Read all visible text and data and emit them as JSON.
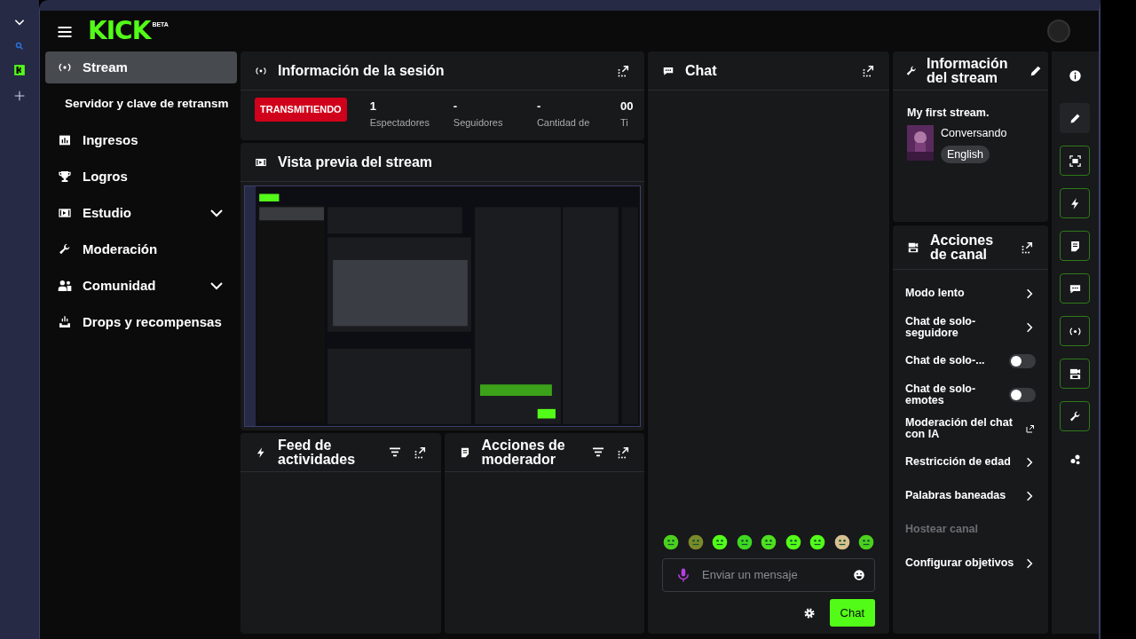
{
  "logo": {
    "text": "KICK",
    "badge": "BETA"
  },
  "sidebar": {
    "items": [
      {
        "label": "Stream",
        "selected": true
      },
      {
        "label": "Servidor y clave de retransm",
        "selected": false
      },
      {
        "label": "Ingresos",
        "selected": false
      },
      {
        "label": "Logros",
        "selected": false
      },
      {
        "label": "Estudio",
        "selected": false,
        "expanded": false
      },
      {
        "label": "Moderación",
        "selected": false
      },
      {
        "label": "Comunidad",
        "selected": false,
        "expanded": false
      },
      {
        "label": "Drops y recompensas",
        "selected": false
      }
    ]
  },
  "session": {
    "title": "Información de la sesión",
    "status": "TRANSMITIENDO",
    "stats": [
      {
        "value": "1",
        "label": "Espectadores"
      },
      {
        "value": "-",
        "label": "Seguidores"
      },
      {
        "value": "-",
        "label": "Cantidad de"
      },
      {
        "value": "00",
        "label": "Ti"
      }
    ]
  },
  "preview": {
    "title": "Vista previa del stream",
    "kind": "picture"
  },
  "activity_feed": {
    "title": "Feed de actividades"
  },
  "mod_actions": {
    "title": "Acciones de moderador"
  },
  "chat": {
    "title": "Chat",
    "placeholder": "Enviar un mensaje",
    "send_button": "Chat"
  },
  "stream_info": {
    "title": "Información del stream",
    "stream_title": "My first stream.",
    "category": "Conversando",
    "tag": "English"
  },
  "channel_actions": {
    "title": "Acciones de canal",
    "items": [
      {
        "label": "Modo lento",
        "kind": "chevron",
        "disabled": false
      },
      {
        "label": "Chat de solo-seguidore",
        "kind": "chevron",
        "disabled": false
      },
      {
        "label": "Chat de solo-...",
        "kind": "toggle",
        "on": false,
        "disabled": false
      },
      {
        "label": "Chat de solo-emotes",
        "kind": "toggle",
        "on": false,
        "disabled": false
      },
      {
        "label": "Moderación del chat con IA",
        "kind": "external",
        "disabled": false
      },
      {
        "label": "Restricción de edad",
        "kind": "chevron",
        "disabled": false
      },
      {
        "label": "Palabras baneadas",
        "kind": "chevron",
        "disabled": false
      },
      {
        "label": "Hostear canal",
        "kind": "plain",
        "disabled": true
      },
      {
        "label": "Configurar objetivos",
        "kind": "chevron",
        "disabled": false
      }
    ]
  }
}
